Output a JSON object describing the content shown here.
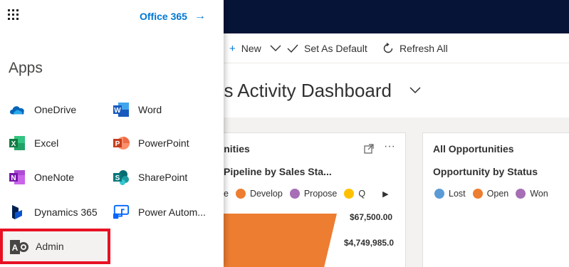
{
  "launcher": {
    "waffle_icon": "app-launcher-icon",
    "office_link": "Office 365",
    "office_arrow": "→",
    "heading": "Apps",
    "apps_left": [
      {
        "label": "OneDrive",
        "icon": "onedrive-icon",
        "color": "#0364b8"
      },
      {
        "label": "Excel",
        "icon": "excel-icon",
        "color": "#107c41"
      },
      {
        "label": "OneNote",
        "icon": "onenote-icon",
        "color": "#7719aa"
      },
      {
        "label": "Dynamics 365",
        "icon": "dynamics-icon",
        "color": "#002050"
      }
    ],
    "apps_right": [
      {
        "label": "Word",
        "icon": "word-icon",
        "color": "#185abd"
      },
      {
        "label": "PowerPoint",
        "icon": "powerpoint-icon",
        "color": "#c43e1c"
      },
      {
        "label": "SharePoint",
        "icon": "sharepoint-icon",
        "color": "#036c70"
      },
      {
        "label": "Power Autom...",
        "icon": "power-automate-icon",
        "color": "#0066ff"
      }
    ],
    "admin": {
      "label": "Admin",
      "icon": "admin-icon",
      "highlight_color": "#e81123"
    }
  },
  "commandbar": {
    "new_label": "New",
    "set_default_label": "Set As Default",
    "refresh_label": "Refresh All"
  },
  "dashboard": {
    "title": "es Activity Dashboard"
  },
  "card1": {
    "title": "tunities",
    "subtitle": "Pipeline by Sales Sta...",
    "legend": [
      {
        "label": "e",
        "color": "#ed7d31"
      },
      {
        "label": "Develop",
        "color": "#ed7d31"
      },
      {
        "label": "Propose",
        "color": "#a66fb5"
      },
      {
        "label": "Q",
        "color": "#ffc000"
      }
    ],
    "legend_more": "▶",
    "values": [
      "$67,500.00",
      "$4,749,985.0"
    ]
  },
  "card2": {
    "title": "All Opportunities",
    "subtitle": "Opportunity by Status",
    "legend": [
      {
        "label": "Lost",
        "color": "#5b9bd5"
      },
      {
        "label": "Open",
        "color": "#ed7d31"
      },
      {
        "label": "Won",
        "color": "#a66fb5"
      }
    ]
  },
  "colors": {
    "nav_dark": "#061438",
    "accent": "#0078d4",
    "funnel_orange": "#ed7d31"
  }
}
